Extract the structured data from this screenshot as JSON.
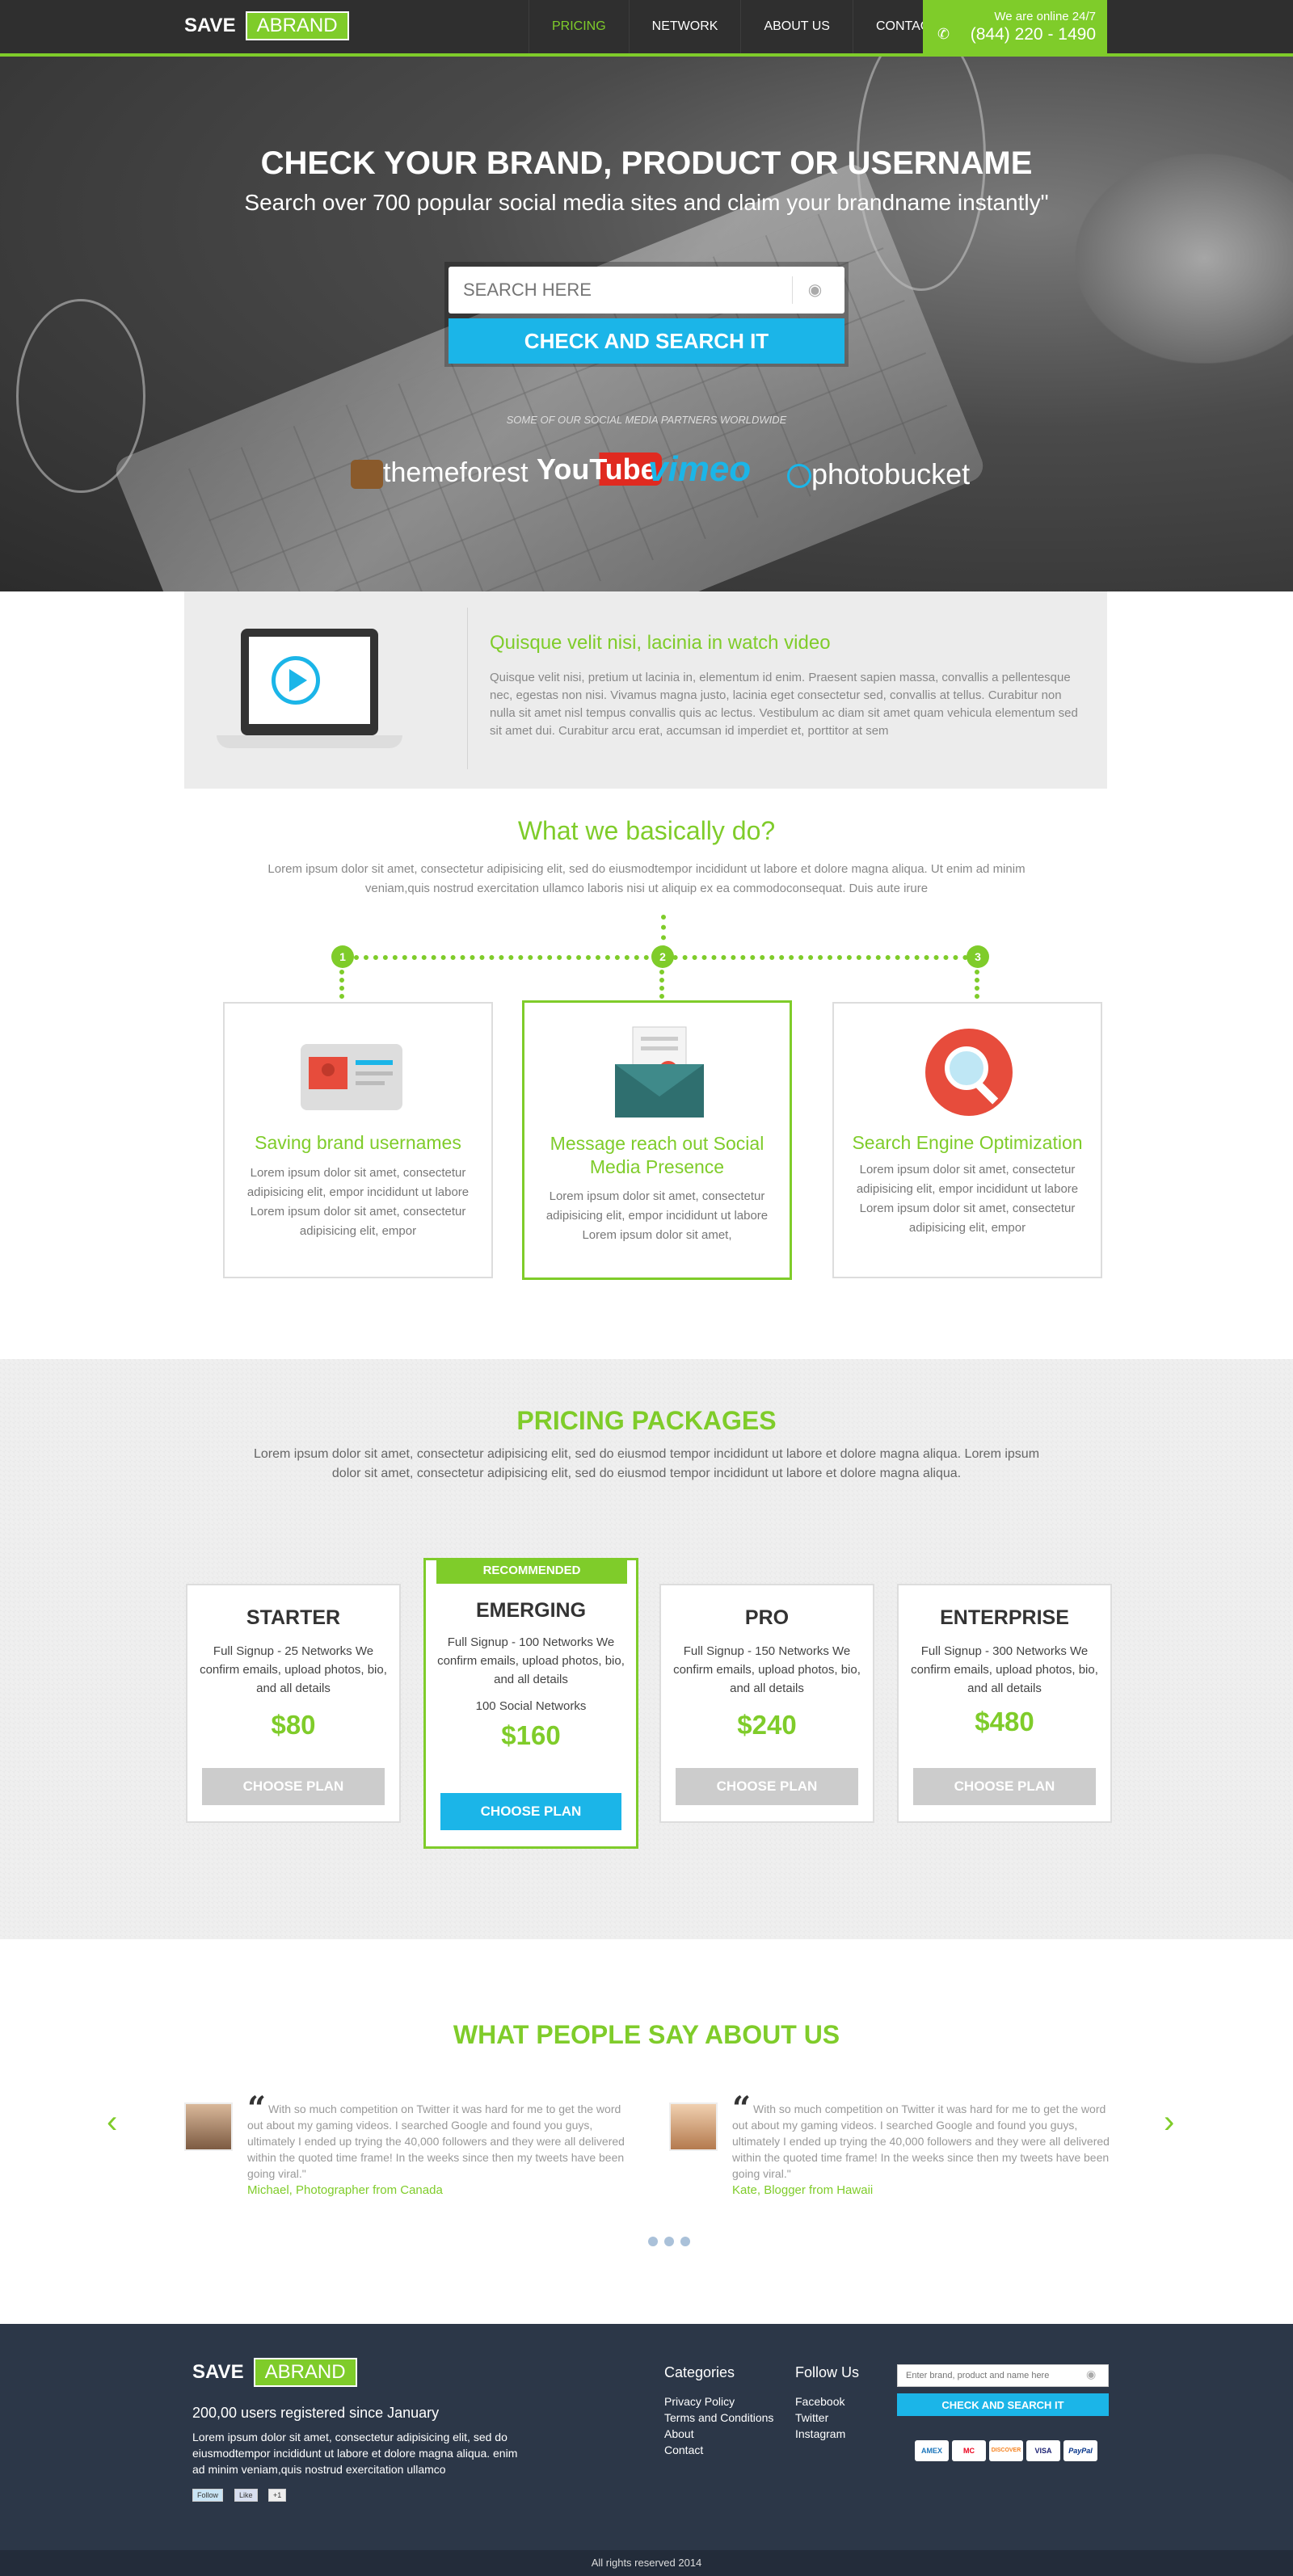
{
  "nav": {
    "logo_save": "SAVE",
    "logo_brand": "ABRAND",
    "links": [
      "PRICING",
      "NETWORK",
      "ABOUT US",
      "CONTACT"
    ],
    "online_text": "We are online 24/7",
    "phone": "(844) 220 - 1490",
    "accent_color": "#7fcc2a"
  },
  "hero": {
    "title": "CHECK YOUR  BRAND, PRODUCT OR USERNAME",
    "subtitle": "Search over 700 popular social media sites and claim your brandname instantly\"",
    "search_placeholder": "SEARCH HERE",
    "search_button": "CHECK AND SEARCH IT",
    "partners_title": "SOME OF OUR SOCIAL MEDIA PARTNERS WORLDWIDE",
    "partners": [
      "themeforest",
      "YouTube",
      "vimeo",
      "photobucket"
    ],
    "button_color": "#1bb5e8"
  },
  "video": {
    "title": "Quisque velit nisi, lacinia in watch video",
    "text": "Quisque velit nisi, pretium ut lacinia in, elementum id enim. Praesent sapien massa, convallis a pellentesque nec, egestas non nisi. Vivamus magna justo, lacinia eget consectetur sed, convallis at tellus. Curabitur non nulla sit amet nisl tempus convallis quis ac lectus. Vestibulum ac diam sit amet quam vehicula elementum sed sit amet dui. Curabitur arcu erat, accumsan id imperdiet et, porttitor at sem"
  },
  "what": {
    "title": "What we basically do?",
    "text": "Lorem ipsum dolor sit amet, consectetur adipisicing elit, sed do eiusmodtempor incididunt ut labore et dolore magna aliqua. Ut enim ad minim veniam,quis nostrud exercitation ullamco laboris nisi ut aliquip ex ea commodoconsequat. Duis aute irure",
    "steps": [
      "1",
      "2",
      "3"
    ],
    "services": [
      {
        "title": "Saving brand usernames",
        "text": "Lorem ipsum dolor sit amet, consectetur adipisicing elit, empor incididunt ut labore Lorem ipsum dolor sit amet, consectetur adipisicing elit, empor"
      },
      {
        "title": "Message reach out Social Media Presence",
        "text": "Lorem ipsum dolor sit amet, consectetur adipisicing elit, empor incididunt ut labore Lorem ipsum dolor sit amet,"
      },
      {
        "title": "Search Engine Optimization",
        "text": "Lorem ipsum dolor sit amet, consectetur adipisicing elit, empor incididunt ut labore Lorem ipsum dolor sit amet, consectetur adipisicing elit, empor"
      }
    ]
  },
  "pricing": {
    "title": "PRICING PACKAGES",
    "text": "Lorem ipsum dolor sit amet, consectetur adipisicing elit, sed do eiusmod tempor incididunt ut labore et dolore magna aliqua. Lorem ipsum dolor sit amet, consectetur adipisicing elit, sed do eiusmod tempor incididunt ut labore et dolore magna aliqua.",
    "badge": "RECOMMENDED",
    "plans": [
      {
        "name": "STARTER",
        "features": "Full Signup - 25 Networks We confirm emails, upload photos, bio, and all details",
        "extra": "",
        "price": "$80",
        "button": "CHOOSE PLAN"
      },
      {
        "name": "EMERGING",
        "features": "Full Signup - 100 Networks We confirm emails, upload photos, bio, and all details",
        "extra": "100 Social Networks",
        "price": "$160",
        "button": "CHOOSE PLAN"
      },
      {
        "name": "PRO",
        "features": "Full Signup - 150 Networks We confirm emails, upload photos, bio, and all details",
        "extra": "",
        "price": "$240",
        "button": "CHOOSE PLAN"
      },
      {
        "name": "ENTERPRISE",
        "features": "Full Signup - 300 Networks We confirm emails, upload photos, bio, and all details",
        "extra": "",
        "price": "$480",
        "button": "CHOOSE PLAN"
      }
    ]
  },
  "testimonials": {
    "title": "WHAT PEOPLE SAY ABOUT US",
    "items": [
      {
        "quote": "With so much competition on Twitter it was hard for me to get the word out about my gaming videos. I searched Google and found you guys, ultimately I ended up trying the 40,000 followers and they were all delivered within the quoted time frame! In the weeks since then my tweets have been going viral.\"",
        "author": "Michael, Photographer from Canada"
      },
      {
        "quote": "With so much competition on Twitter it was hard for me to get the word out about my gaming videos. I searched Google and found you guys, ultimately I ended up trying the 40,000 followers and they were all delivered within the quoted time frame! In the weeks since then my tweets have been going viral.\"",
        "author": "Kate, Blogger from Hawaii"
      }
    ]
  },
  "footer": {
    "logo_save": "SAVE",
    "logo_brand": "ABRAND",
    "tagline": "200,00 users  registered since January",
    "text": "Lorem ipsum dolor sit amet, consectetur adipisicing elit, sed do eiusmodtempor incididunt ut labore et dolore magna aliqua. enim ad minim veniam,quis nostrud exercitation ullamco",
    "social_buttons": [
      "Follow",
      "Like",
      "+1"
    ],
    "categories_title": "Categories",
    "categories": [
      "Privacy Policy",
      "Terms and Conditions",
      "About",
      "Contact"
    ],
    "follow_title": "Follow Us",
    "follow": [
      "Facebook",
      "Twitter",
      "Instagram"
    ],
    "input_placeholder": "Enter brand, product and name here",
    "button": "CHECK AND SEARCH IT",
    "payments": [
      "AMEX",
      "MC",
      "DISCOVER",
      "VISA",
      "PayPal"
    ],
    "copyright": "All rights reserved 2014"
  }
}
